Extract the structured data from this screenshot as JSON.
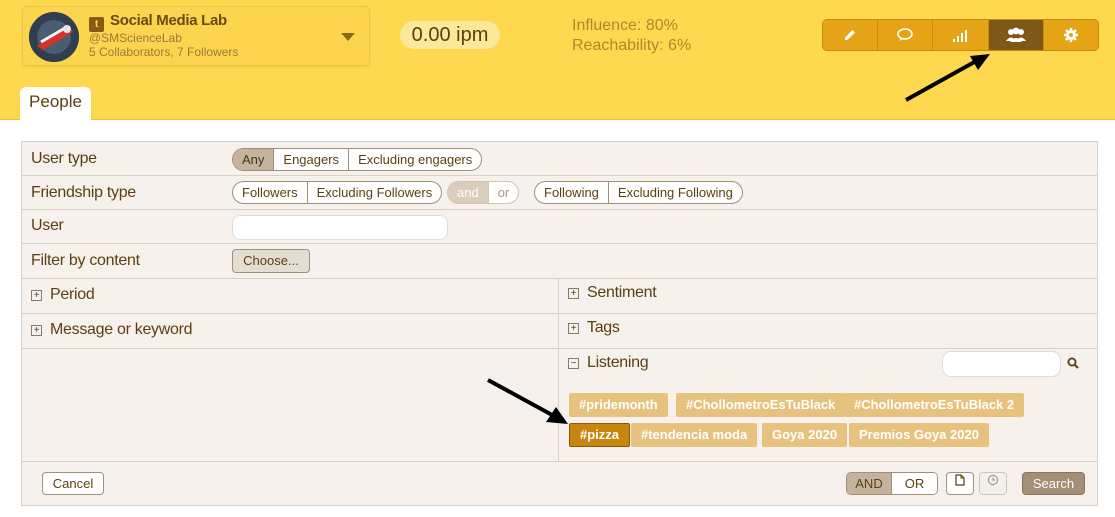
{
  "account": {
    "name": "Social Media Lab",
    "handle": "@SMScienceLab",
    "stats": "5 Collaborators, 7 Followers"
  },
  "ipm": "0.00 ipm",
  "metrics": {
    "influence": "Influence: 80%",
    "reachability": "Reachability: 6%"
  },
  "toolbar": [
    "pencil-icon",
    "chat-bubble-icon",
    "signal-bars-icon",
    "people-icon",
    "gear-icon"
  ],
  "tab": "People",
  "filters": {
    "user_type": {
      "label": "User type",
      "options": [
        "Any",
        "Engagers",
        "Excluding engagers"
      ]
    },
    "friendship_type": {
      "label": "Friendship type",
      "group1": [
        "Followers",
        "Excluding Followers"
      ],
      "logic": [
        "and",
        "or"
      ],
      "group2": [
        "Following",
        "Excluding Following"
      ]
    },
    "user": {
      "label": "User",
      "value": ""
    },
    "content": {
      "label": "Filter by content",
      "button": "Choose..."
    }
  },
  "sections": {
    "period": "Period",
    "message": "Message or keyword",
    "sentiment": "Sentiment",
    "tags": "Tags",
    "listening": "Listening"
  },
  "listening_tags": [
    "#pridemonth",
    "#ChollometroEsTuBlack",
    "#ChollometroEsTuBlack 2",
    "#pizza",
    "#tendencia moda",
    "Goya 2020",
    "Premios Goya 2020"
  ],
  "selected_tag": "#pizza",
  "footer": {
    "cancel": "Cancel",
    "and": "AND",
    "or": "OR",
    "search": "Search"
  },
  "colors": {
    "header_bg": "#fed94f",
    "toolbar_bg": "#e4a415",
    "toolbar_active": "#7f5716",
    "tag_bg": "#e7c27f",
    "tag_selected": "#c9860e"
  }
}
